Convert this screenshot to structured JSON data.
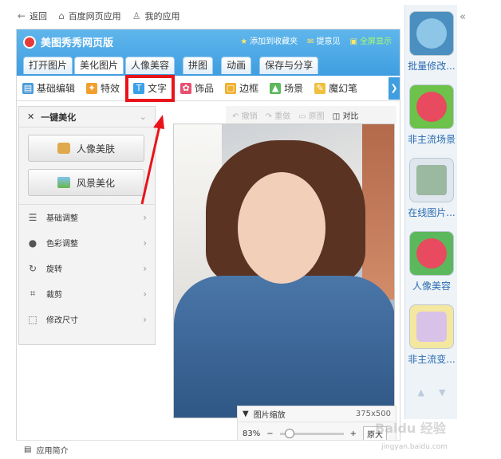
{
  "topnav": {
    "back": "返回",
    "web_apps": "百度网页应用",
    "my_apps": "我的应用"
  },
  "header": {
    "title": "美图秀秀网页版",
    "add_favorite": "添加到收藏夹",
    "feedback": "提意见",
    "fullscreen": "全屏显示"
  },
  "main_tabs": [
    "打开图片",
    "美化图片",
    "人像美容",
    "拼图",
    "动画",
    "保存与分享"
  ],
  "sub_tools": {
    "basic_edit": "基础编辑",
    "effects": "特效",
    "text": "文字",
    "decor": "饰品",
    "border": "边框",
    "scene": "场景",
    "magic_pen": "魔幻笔"
  },
  "left_panel": {
    "header": "一键美化",
    "portrait_btn": "人像美肤",
    "scenery_btn": "风景美化",
    "rows": [
      "基础调整",
      "色彩调整",
      "旋转",
      "裁剪",
      "修改尺寸"
    ]
  },
  "editbar": {
    "undo": "撤销",
    "redo": "重做",
    "original": "原图",
    "compare": "对比"
  },
  "zoom": {
    "label": "图片缩放",
    "dimensions": "375x500",
    "percent": "83%",
    "original_size": "原大"
  },
  "footer": {
    "app_intro": "应用简介"
  },
  "right_apps": [
    "批量修改...",
    "非主流场景",
    "在线图片...",
    "人像美容",
    "非主流变..."
  ],
  "watermark": {
    "brand": "Baidu 经验",
    "url": "jingyan.baidu.com"
  },
  "colors": {
    "header_blue": "#3f9ee0",
    "highlight_red": "#e8141a",
    "link_blue": "#2a6bb0"
  }
}
